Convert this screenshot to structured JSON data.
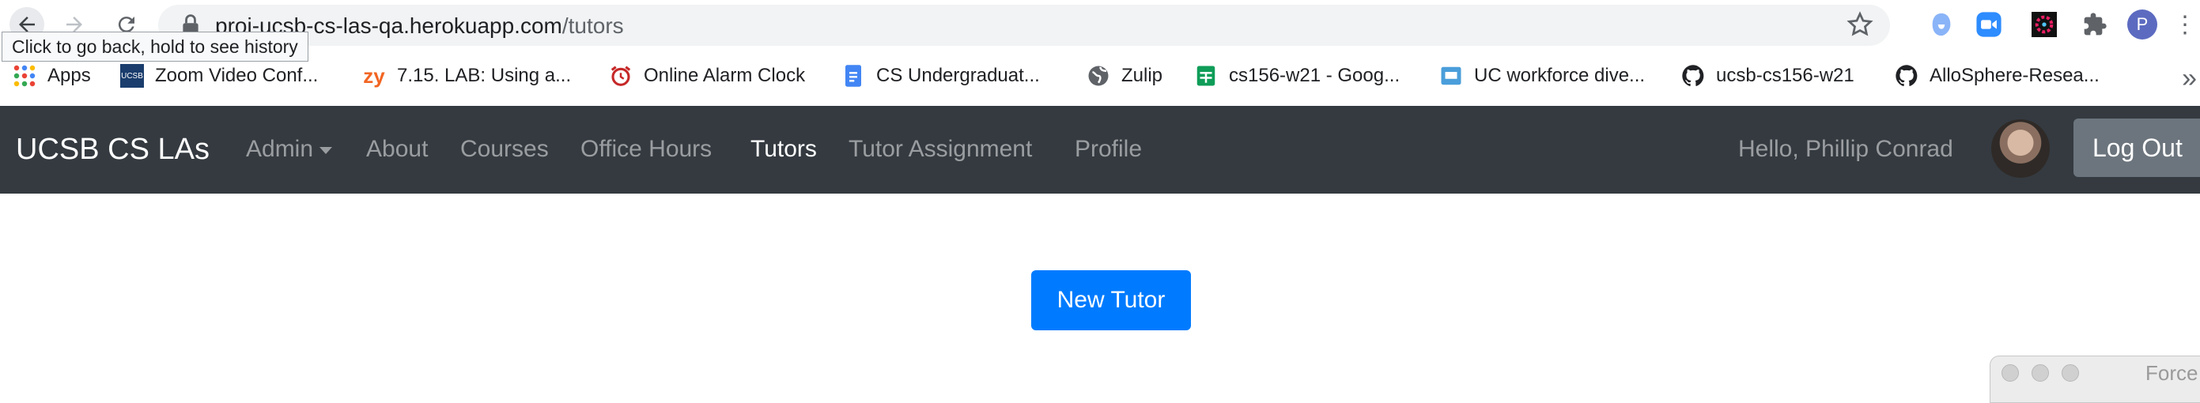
{
  "browser": {
    "url_host": "proj-ucsb-cs-las-qa.herokuapp.com",
    "url_path": "/tutors",
    "back_tooltip": "Click to go back, hold to see history",
    "profile_initial": "P"
  },
  "bookmarks": [
    {
      "label": "Apps",
      "icon": "apps-grid-icon"
    },
    {
      "label": "Zoom Video Conf...",
      "icon": "ucsb-icon",
      "icon_text": "UCSB"
    },
    {
      "label": "7.15. LAB: Using a...",
      "icon": "zybooks-icon",
      "icon_text": "zy"
    },
    {
      "label": "Online Alarm Clock",
      "icon": "alarm-clock-icon"
    },
    {
      "label": "CS Undergraduat...",
      "icon": "google-docs-icon"
    },
    {
      "label": "Zulip",
      "icon": "globe-icon"
    },
    {
      "label": "cs156-w21 - Goog...",
      "icon": "google-sheets-icon"
    },
    {
      "label": "UC workforce dive...",
      "icon": "google-slides-icon"
    },
    {
      "label": "ucsb-cs156-w21",
      "icon": "github-icon"
    },
    {
      "label": "AlloSphere-Resea...",
      "icon": "github-icon"
    }
  ],
  "navbar": {
    "brand": "UCSB CS LAs",
    "links": [
      "Admin",
      "About",
      "Courses",
      "Office Hours",
      "Tutors",
      "Tutor Assignment",
      "Profile"
    ],
    "active": "Tutors",
    "greeting": "Hello, Phillip Conrad",
    "logout_label": "Log Out"
  },
  "main": {
    "new_tutor_label": "New Tutor"
  },
  "floating_window": {
    "title": "Force"
  },
  "colors": {
    "navbar_bg": "#343a40",
    "primary": "#007bff",
    "secondary": "#6c757d"
  }
}
